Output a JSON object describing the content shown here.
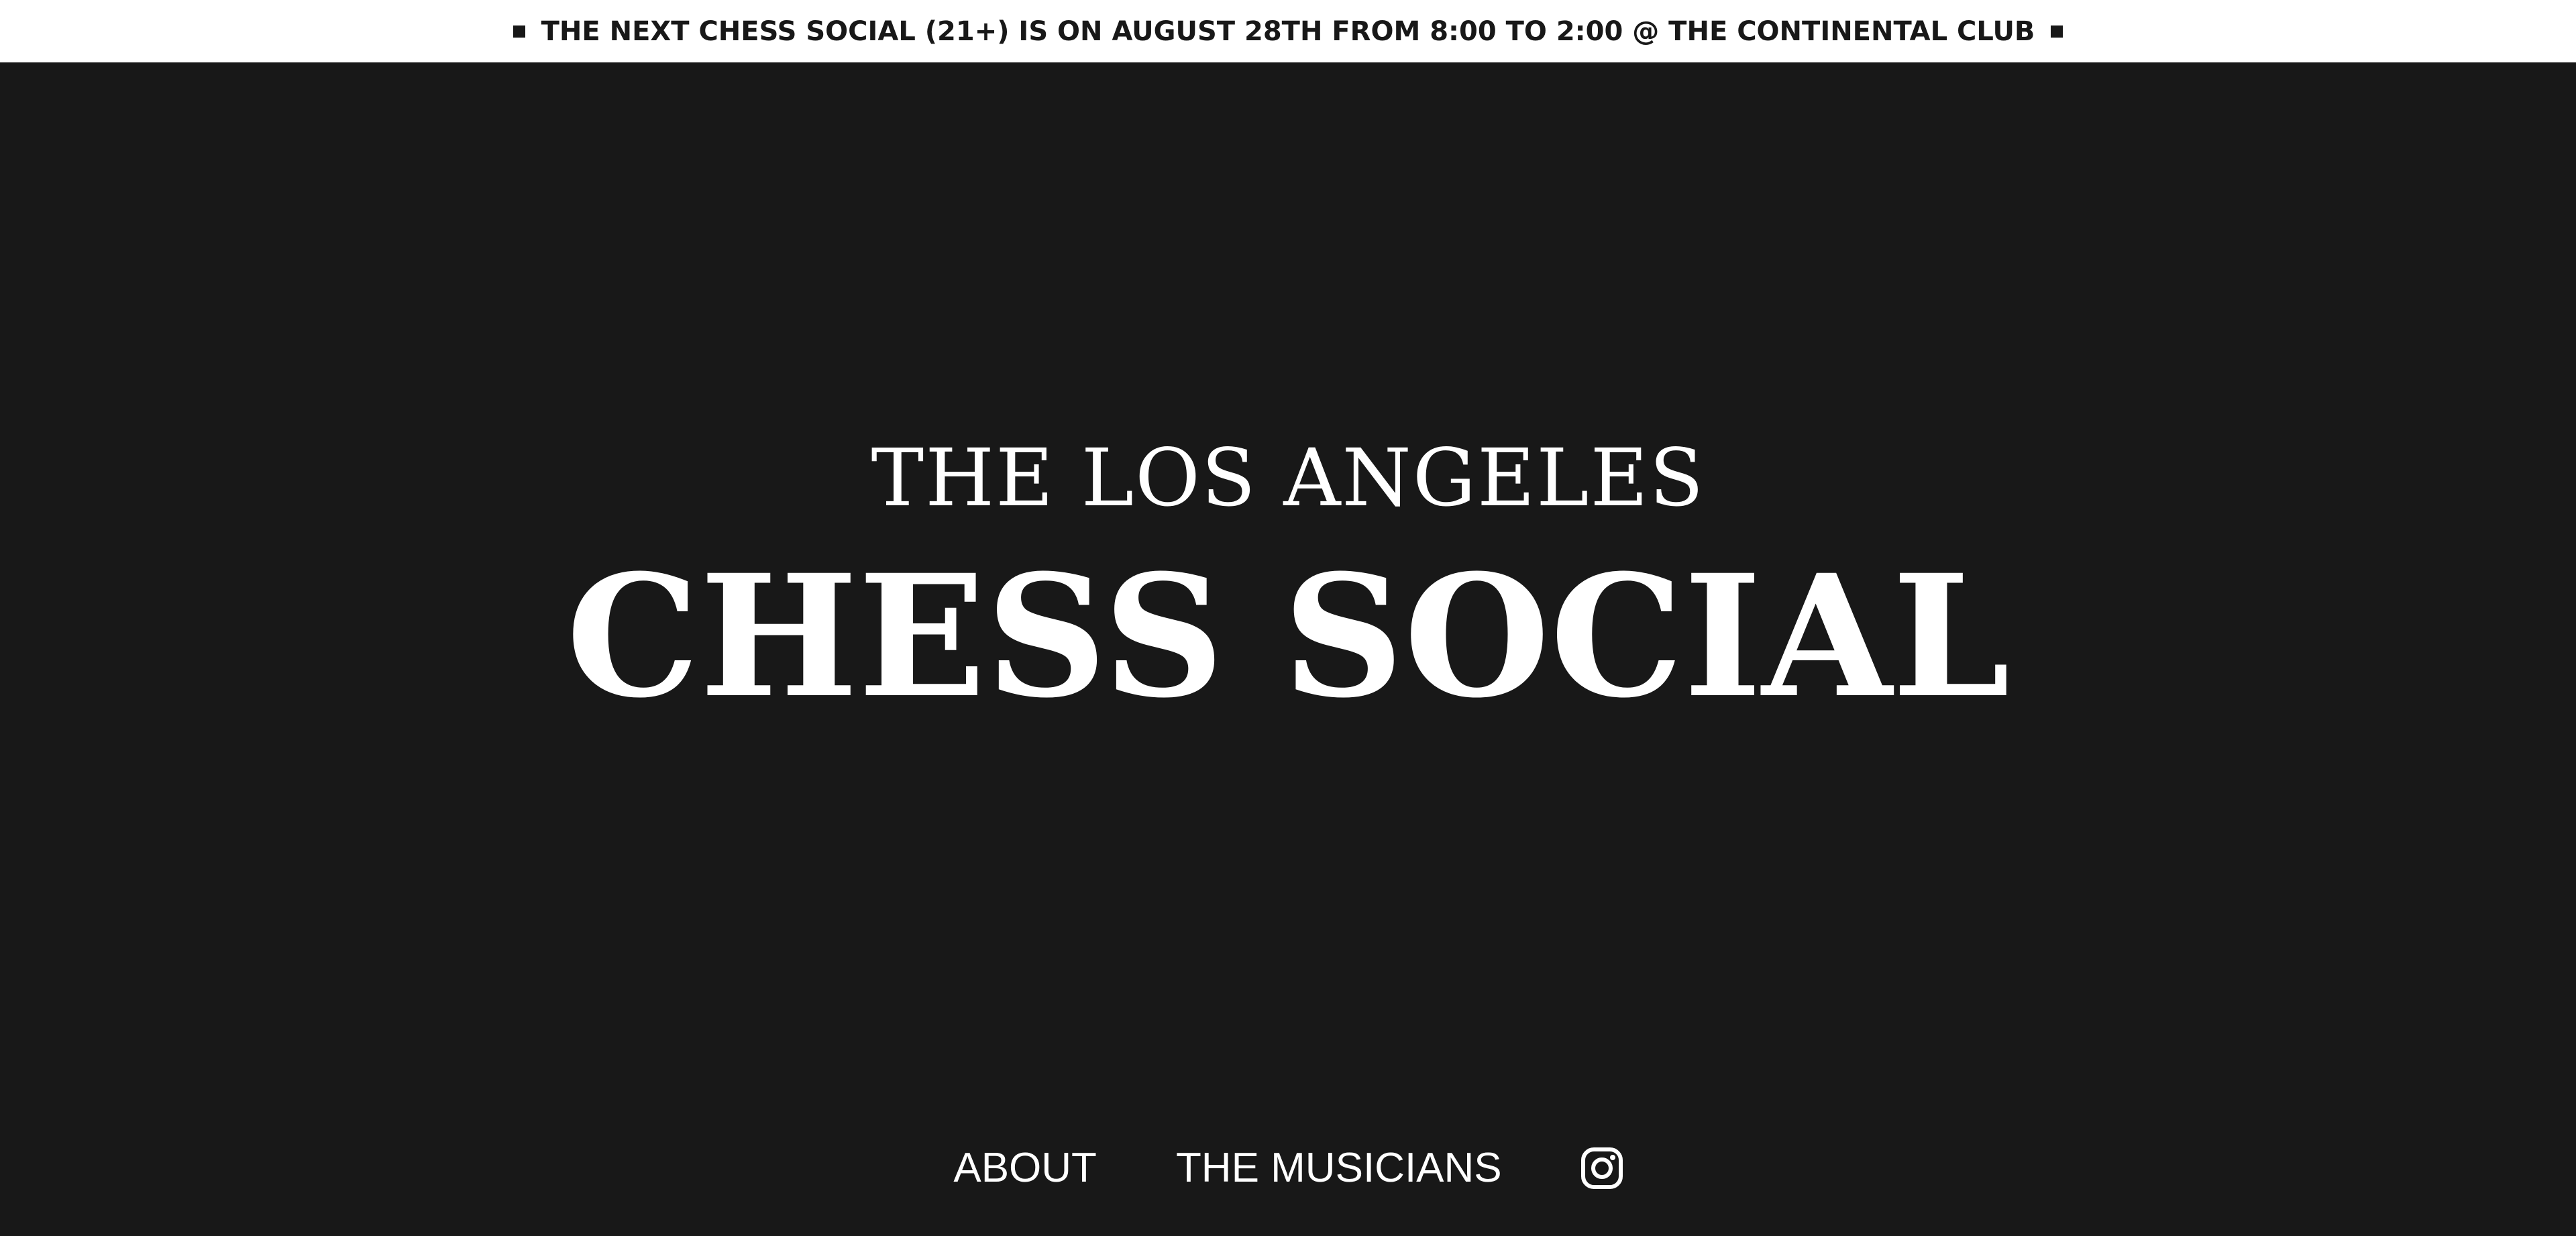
{
  "announcement": {
    "text": "THE NEXT CHESS SOCIAL (21+) IS ON AUGUST 28TH FROM 8:00 TO 2:00 @ THE CONTINENTAL CLUB"
  },
  "hero": {
    "kicker": "THE LOS ANGELES",
    "title": "CHESS SOCIAL"
  },
  "nav": {
    "items": [
      {
        "label": "ABOUT"
      },
      {
        "label": "THE MUSICIANS"
      }
    ],
    "instagram_icon": "instagram-icon"
  },
  "colors": {
    "background": "#181818",
    "announcement_bg": "#ffffff",
    "text_light": "#ffffff",
    "text_dark": "#181818"
  }
}
